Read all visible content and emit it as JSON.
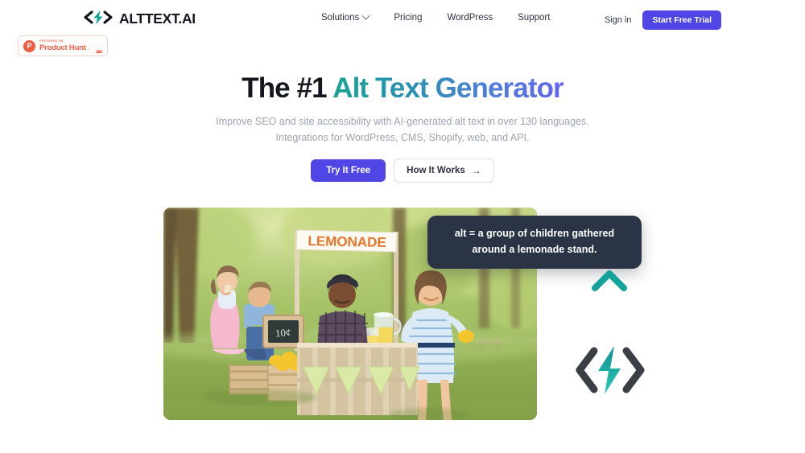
{
  "header": {
    "logo": {
      "icon": "code-bolt-icon",
      "text": "ALTTEXT.AI"
    },
    "nav": [
      {
        "label": "Solutions",
        "icon": "chevron-down-icon",
        "has_dropdown": true
      },
      {
        "label": "Pricing",
        "has_dropdown": false
      },
      {
        "label": "WordPress",
        "has_dropdown": false
      },
      {
        "label": "Support",
        "has_dropdown": false
      }
    ],
    "signin_label": "Sign in",
    "trial_button_label": "Start Free Trial"
  },
  "product_hunt": {
    "logo_letter": "P",
    "featured_label": "FEATURED ON",
    "name": "Product Hunt",
    "upvotes": "159",
    "upvote_icon": "caret-up-icon"
  },
  "hero": {
    "headline_dark": "The #1 ",
    "headline_gradient": "Alt Text Generator",
    "subhead_line1": "Improve SEO and site accessibility with AI-generated alt text in over 130 languages.",
    "subhead_line2": "Integrations for WordPress, CMS, Shopify, web, and API.",
    "cta_primary": "Try It Free",
    "cta_secondary": "How It Works",
    "cta_secondary_icon": "arrow-right-icon"
  },
  "alt_tooltip": {
    "text": "alt = a group of children gathered around a lemonade stand."
  },
  "hero_image": {
    "alt": "a group of children gathered around a lemonade stand",
    "sign_text": "LEMONADE",
    "price_sign_text": "10¢"
  },
  "code_graphic": {
    "code_icon": "code-brackets-icon",
    "bolt_icon": "lightning-bolt-icon",
    "up_arrow_icon": "dotted-arrow-up-icon",
    "left_line_icon": "dotted-line-horizontal-icon"
  },
  "colors": {
    "brand_purple": "#4f46e5",
    "brand_teal": "#16a394",
    "product_hunt_red": "#ee5c43",
    "tooltip_bg": "#2b3444",
    "text_dark": "#15171f",
    "text_muted": "#9ea3b0",
    "code_dark": "#3b3f45"
  }
}
